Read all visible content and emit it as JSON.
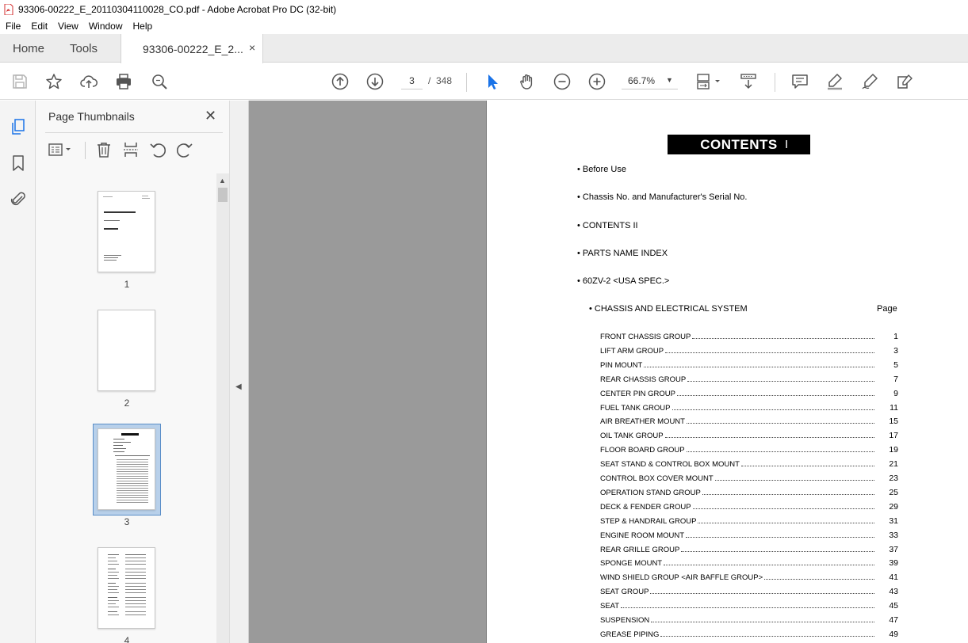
{
  "window": {
    "title": "93306-00222_E_20110304110028_CO.pdf - Adobe Acrobat Pro DC (32-bit)"
  },
  "menu": [
    "File",
    "Edit",
    "View",
    "Window",
    "Help"
  ],
  "tabs": {
    "home": "Home",
    "tools": "Tools",
    "document": "93306-00222_E_2...",
    "close": "×"
  },
  "toolbar": {
    "current_page": "3",
    "page_separator": "/",
    "total_pages": "348",
    "zoom": "66.7%",
    "icons": [
      "save-icon",
      "bookmark-star-icon",
      "upload-icon",
      "print-icon",
      "search-icon",
      "page-up-icon",
      "page-down-icon",
      "select-arrow-icon",
      "hand-icon",
      "zoom-out-icon",
      "zoom-in-icon",
      "page-layout-icon",
      "scroll-mode-icon",
      "comment-icon",
      "highlight-icon",
      "sign-icon",
      "edit-pdf-icon"
    ]
  },
  "sidebar": {
    "title": "Page Thumbnails",
    "close": "✕",
    "thumbnails": [
      {
        "label": "1"
      },
      {
        "label": "2"
      },
      {
        "label": "3"
      },
      {
        "label": "4"
      }
    ]
  },
  "document": {
    "heading": "CONTENTS",
    "bullets": [
      "• Before Use",
      "• Chassis No.  and Manufacturer's Serial No.",
      "• CONTENTS II",
      "• PARTS NAME INDEX",
      "• 60ZV-2 <USA SPEC.>"
    ],
    "section": "• CHASSIS AND ELECTRICAL SYSTEM",
    "page_label": "Page",
    "toc": [
      {
        "name": "FRONT CHASSIS GROUP",
        "page": "1"
      },
      {
        "name": "LIFT ARM GROUP",
        "page": "3"
      },
      {
        "name": "PIN MOUNT",
        "page": "5"
      },
      {
        "name": "REAR CHASSIS GROUP",
        "page": "7"
      },
      {
        "name": "CENTER PIN GROUP",
        "page": "9"
      },
      {
        "name": "FUEL TANK GROUP",
        "page": "11"
      },
      {
        "name": "AIR BREATHER MOUNT",
        "page": "15"
      },
      {
        "name": "OIL TANK GROUP",
        "page": "17"
      },
      {
        "name": "FLOOR BOARD GROUP",
        "page": "19"
      },
      {
        "name": "SEAT STAND & CONTROL BOX MOUNT",
        "page": "21"
      },
      {
        "name": "CONTROL BOX COVER MOUNT",
        "page": "23"
      },
      {
        "name": "OPERATION STAND GROUP",
        "page": "25"
      },
      {
        "name": "DECK & FENDER GROUP",
        "page": "29"
      },
      {
        "name": "STEP & HANDRAIL GROUP",
        "page": "31"
      },
      {
        "name": "ENGINE ROOM MOUNT",
        "page": "33"
      },
      {
        "name": "REAR GRILLE GROUP",
        "page": "37"
      },
      {
        "name": "SPONGE MOUNT",
        "page": "39"
      },
      {
        "name": "WIND SHIELD GROUP <AIR BAFFLE GROUP>",
        "page": "41"
      },
      {
        "name": "SEAT GROUP",
        "page": "43"
      },
      {
        "name": "SEAT",
        "page": "45"
      },
      {
        "name": "SUSPENSION",
        "page": "47"
      },
      {
        "name": "GREASE PIPING",
        "page": "49"
      }
    ]
  },
  "colors": {
    "accent_blue": "#1a73e8",
    "doc_background": "#9a9a9a",
    "selected_thumb": "#b8d0ea"
  }
}
